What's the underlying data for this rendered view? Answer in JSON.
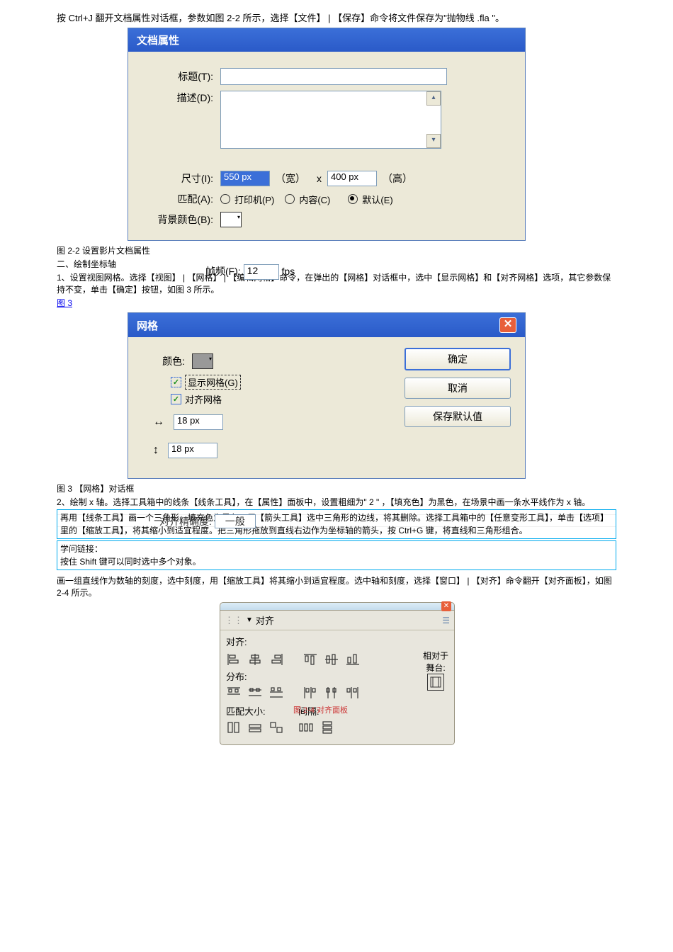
{
  "intro": "按 Ctrl+J 翻开文档属性对话框，参数如图 2-2 所示，选择【文件】 | 【保存】命令将文件保存为\"抛物线 .fla \"。",
  "doc_dialog": {
    "title": "文档属性",
    "label_title": "标题(T):",
    "label_desc": "描述(D):",
    "label_size": "尺寸(I):",
    "size_w": "550 px",
    "size_w_label": "（宽）",
    "size_x": "x",
    "size_h": "400 px",
    "size_h_label": "（高）",
    "label_match": "匹配(A):",
    "match_printer": "打印机(P)",
    "match_content": "内容(C)",
    "match_default": "默认(E)",
    "label_bg": "背景颜色(B):",
    "label_fps": "帧频(F):",
    "fps_value": "12",
    "fps_unit": "fps"
  },
  "caption_2_2": "图 2-2  设置影片文档属性",
  "section2_title": "二、绘制坐标轴",
  "section2_line1": "1、设置视图网格。选择【视图】 | 【网格】 | 【编辑网格】命令，在弹出的【网格】对话框中，选中【显示网格】和【对齐网格】选项，其它参数保持不变，单击【确定】按钮，如图 3 所示。",
  "grid_dialog": {
    "title": "网格",
    "label_color": "颜色:",
    "chk_show": "显示网格(G)",
    "chk_snap": "对齐网格",
    "val_h": "18 px",
    "val_v": "18 px",
    "btn_ok": "确定",
    "btn_cancel": "取消",
    "btn_save": "保存默认值",
    "label_accuracy": "对齐精确度:",
    "accuracy_val": "一般"
  },
  "caption_3": "图 3 【网格】对话框",
  "line_draw_x": "2、绘制 x 轴。选择工具箱中的线条【线条工具】，在【属性】面板中，设置粗细为\" 2 \" ，【填充色】为黑色，在场景中画一条水平线作为 x 轴。",
  "line_arrow": "再用【线条工具】画一个三角形，填充色为黑色，用【箭头工具】选中三角形的边线，将其删除。选择工具箱中的【任意变形工具】，单击【选项】里的【缩放工具】，将其缩小到适宜程度。把三角形拖放到直线右边作为坐标轴的箭头，按 Ctrl+G 键，将直线和三角形组合。",
  "tip_title": "学问链接：",
  "tip_body": "按住 Shift 键可以同时选中多个对象。",
  "scale_line": "画一组直线作为数轴的刻度，选中刻度，用【缩放工具】将其缩小到适宜程度。选中轴和刻度，选择【窗口】 | 【对齐】命令翻开【对齐面板】，如图 2-4 所示。",
  "align_panel": {
    "title": "对齐",
    "sec_align": "对齐:",
    "sec_distribute": "分布:",
    "sec_match": "匹配大小:",
    "sec_space": "间隔:",
    "stage_l1": "相对于",
    "stage_l2": "舞台:",
    "caption": "图 2-4  对齐面板"
  }
}
